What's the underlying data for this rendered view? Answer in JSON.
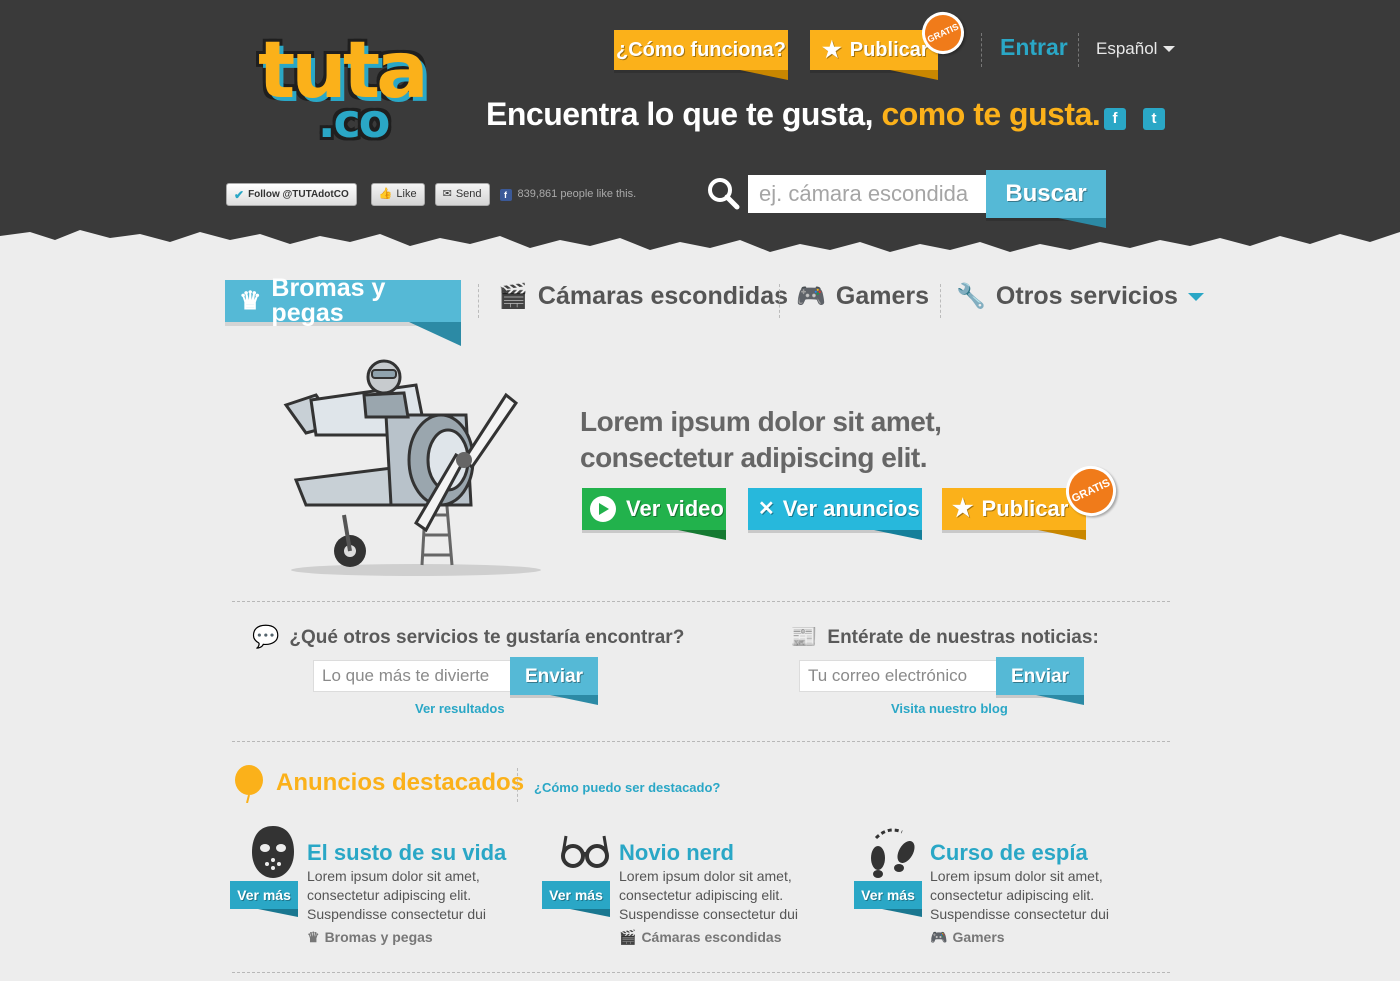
{
  "header": {
    "logo_main": "tuta",
    "logo_sub": ".co",
    "how_it_works": "¿Cómo funciona?",
    "publish": "Publicar",
    "gratis": "GRATIS",
    "login": "Entrar",
    "language": "Español",
    "tagline_plain": "Encuentra lo que te gusta,",
    "tagline_highlight": "como te gusta.",
    "facebook_glyph": "f",
    "twitter_glyph": "t"
  },
  "social": {
    "follow": "Follow @TUTAdotCO",
    "like": "Like",
    "send": "Send",
    "likes_text": "839,861 people like this."
  },
  "search": {
    "placeholder": "ej. cámara escondida",
    "button": "Buscar"
  },
  "nav": {
    "items": [
      {
        "label": "Bromas y pegas",
        "icon": "crown-icon",
        "active": true
      },
      {
        "label": "Cámaras escondidas",
        "icon": "clapperboard-icon",
        "active": false
      },
      {
        "label": "Gamers",
        "icon": "gamepad-icon",
        "active": false
      },
      {
        "label": "Otros servicios",
        "icon": "tools-icon",
        "active": false
      }
    ]
  },
  "hero": {
    "line1": "Lorem ipsum dolor sit amet,",
    "line2": "consectetur adipiscing elit.",
    "watch_video": "Ver video",
    "view_ads": "Ver anuncios",
    "publish": "Publicar",
    "gratis": "GRATIS"
  },
  "suggest": {
    "title": "¿Qué otros servicios te gustaría encontrar?",
    "placeholder": "Lo que más te divierte",
    "button": "Enviar",
    "link": "Ver resultados"
  },
  "newsletter": {
    "title": "Entérate de nuestras noticias:",
    "placeholder": "Tu correo electrónico",
    "button": "Enviar",
    "link": "Visita nuestro blog"
  },
  "featured": {
    "title": "Anuncios destacados",
    "link": "¿Cómo puedo ser destacado?",
    "cards": [
      {
        "title": "El susto de su vida",
        "desc": "Lorem ipsum dolor sit amet, consectetur adipiscing elit. Suspendisse consectetur dui",
        "category": "Bromas y pegas",
        "more": "Ver más",
        "icon": "hockey-mask-icon"
      },
      {
        "title": "Novio nerd",
        "desc": "Lorem ipsum dolor sit amet, consectetur adipiscing elit. Suspendisse consectetur dui",
        "category": "Cámaras escondidas",
        "more": "Ver más",
        "icon": "glasses-icon"
      },
      {
        "title": "Curso de espía",
        "desc": "Lorem ipsum dolor sit amet, consectetur adipiscing elit. Suspendisse consectetur dui",
        "category": "Gamers",
        "more": "Ver más",
        "icon": "footprints-icon"
      }
    ]
  },
  "colors": {
    "yellow": "#fbb11a",
    "teal": "#2aa7c6",
    "green": "#22b24c",
    "dark": "#3a3a3a",
    "orange": "#f07b1a"
  }
}
